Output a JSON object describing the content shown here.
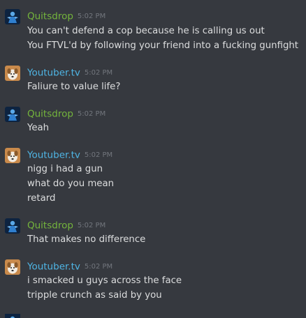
{
  "colors": {
    "background": "#36393f",
    "quitsdrop_name": "#74b53c",
    "youtuber_name": "#4fb5e4",
    "timestamp": "#72767d",
    "message_text": "#dcddde"
  },
  "messages": [
    {
      "author": "Quitsdrop",
      "time": "5:02 PM",
      "avatar_icon": "blue-figure-avatar",
      "lines": [
        "You can't defend a cop because he is calling us out",
        "You FTVL'd by following your friend into a fucking gunfight"
      ]
    },
    {
      "author": "Youtuber.tv",
      "time": "5:02 PM",
      "avatar_icon": "dog-avatar",
      "lines": [
        "Faliure to value life?"
      ]
    },
    {
      "author": "Quitsdrop",
      "time": "5:02 PM",
      "avatar_icon": "blue-figure-avatar",
      "lines": [
        "Yeah"
      ]
    },
    {
      "author": "Youtuber.tv",
      "time": "5:02 PM",
      "avatar_icon": "dog-avatar",
      "lines": [
        "nigg i had a gun",
        "what do you mean",
        "retard"
      ]
    },
    {
      "author": "Quitsdrop",
      "time": "5:02 PM",
      "avatar_icon": "blue-figure-avatar",
      "lines": [
        "That makes no difference"
      ]
    },
    {
      "author": "Youtuber.tv",
      "time": "5:02 PM",
      "avatar_icon": "dog-avatar",
      "lines": [
        "i smacked u guys across the face",
        "tripple crunch as said by you"
      ]
    }
  ]
}
